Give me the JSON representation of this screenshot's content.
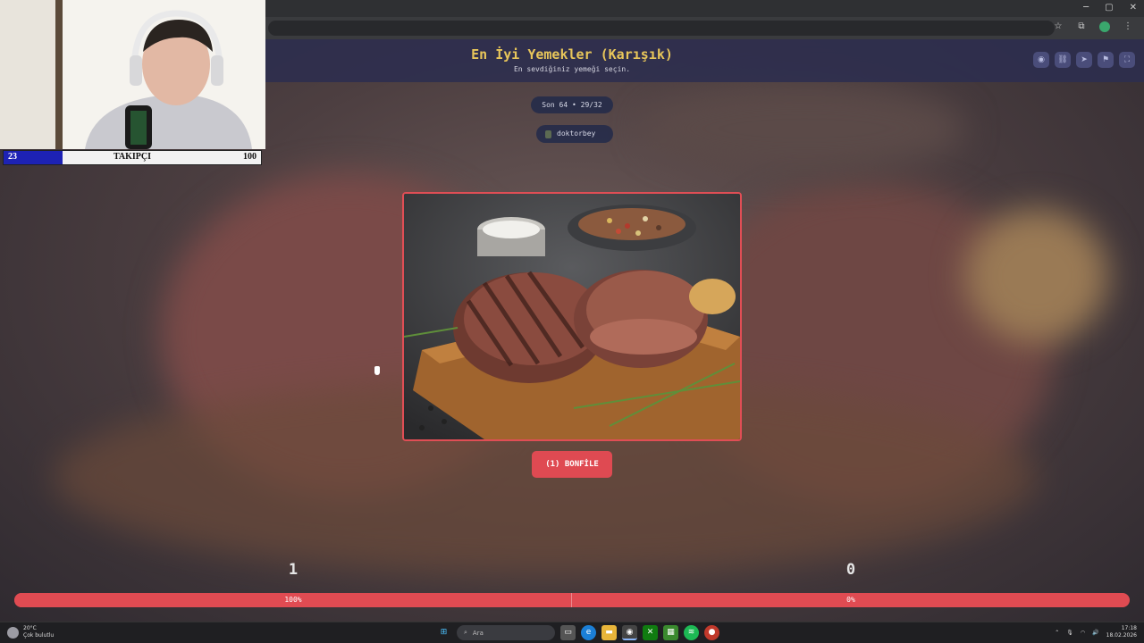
{
  "window": {
    "minimize": "─",
    "maximize": "▢",
    "close": "✕"
  },
  "browser": {
    "bookmark_icon": "star-icon",
    "extensions": [
      "puzzle-icon",
      "profile-icon",
      "menu-icon"
    ]
  },
  "header": {
    "title": "En İyi Yemekler (Karışık)",
    "subtitle": "En sevdiğiniz yemeği seçin.",
    "actions": [
      "eye-icon",
      "link-icon",
      "send-icon",
      "flag-icon",
      "fullscreen-icon"
    ]
  },
  "round": {
    "label": "Son 64 • 29/32"
  },
  "user": {
    "name": "doktorbey"
  },
  "item": {
    "label": "(1) BONFİLE"
  },
  "scores": {
    "left": "1",
    "right": "0"
  },
  "progress": {
    "left_label": "100%",
    "right_label": "0%",
    "left_fraction": 1.0
  },
  "follower_goal": {
    "current": "23",
    "label": "TAKIPÇI",
    "goal": "100",
    "fraction": 0.23
  },
  "taskbar": {
    "weather_temp": "20°C",
    "weather_desc": "Çok bulutlu",
    "search_placeholder": "Ara",
    "time": "17:18",
    "date": "18.02.2026"
  },
  "colors": {
    "accent": "#e04e55",
    "title": "#e8c65a",
    "header_bg": "#2c2e4e"
  }
}
